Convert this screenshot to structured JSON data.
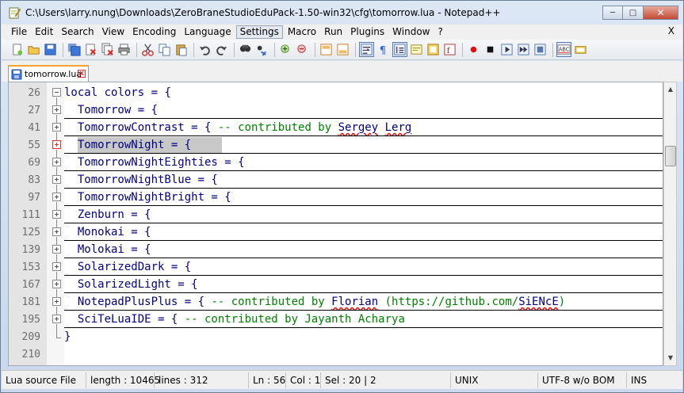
{
  "window": {
    "title": "C:\\Users\\larry.nung\\Downloads\\ZeroBraneStudioEduPack-1.50-win32\\cfg\\tomorrow.lua - Notepad++",
    "minimize_icon": "minimize-icon",
    "maximize_icon": "maximize-icon",
    "close_icon": "close-icon"
  },
  "menu": {
    "items": [
      {
        "label": "File"
      },
      {
        "label": "Edit"
      },
      {
        "label": "Search"
      },
      {
        "label": "View"
      },
      {
        "label": "Encoding"
      },
      {
        "label": "Language"
      },
      {
        "label": "Settings",
        "active": true
      },
      {
        "label": "Macro"
      },
      {
        "label": "Run"
      },
      {
        "label": "Plugins"
      },
      {
        "label": "Window"
      },
      {
        "label": "?"
      }
    ],
    "close_label": "X"
  },
  "toolbar": {
    "icons": [
      "new-file-icon",
      "open-file-icon",
      "save-icon",
      "save-all-icon",
      "close-icon",
      "close-all-icon",
      "print-icon",
      "cut-icon",
      "copy-icon",
      "paste-icon",
      "undo-icon",
      "redo-icon",
      "find-icon",
      "replace-icon",
      "zoom-in-icon",
      "zoom-out-icon",
      "sync-vertical-icon",
      "sync-horizontal-icon",
      "word-wrap-icon",
      "show-all-chars-icon",
      "indent-guide-icon",
      "user-lang-icon",
      "doc-map-icon",
      "function-list-icon",
      "record-macro-icon",
      "stop-record-icon",
      "play-macro-icon",
      "run-macro-multiple-icon",
      "save-macro-icon",
      "spell-check-icon",
      "spell-check-options-icon"
    ]
  },
  "tab": {
    "label": "tomorrow.lua",
    "close_label": "x"
  },
  "editor": {
    "lines": [
      {
        "num": "26",
        "fold": "minus",
        "parts": [
          [
            "kw",
            "local"
          ],
          [
            "op",
            " colors = {"
          ]
        ]
      },
      {
        "num": "27",
        "fold": "plus",
        "parts": [
          [
            "op",
            "  Tomorrow = {"
          ]
        ]
      },
      {
        "num": "41",
        "fold": "plus",
        "parts": [
          [
            "op",
            "  TomorrowContrast = { "
          ],
          [
            "cm",
            "-- contributed by "
          ],
          [
            "sq",
            "Sergey"
          ],
          [
            "cm",
            " "
          ],
          [
            "sq",
            "Lerg"
          ]
        ]
      },
      {
        "num": "55",
        "fold": "plus-red",
        "parts": [
          [
            "op",
            "  TomorrowNight = {"
          ]
        ],
        "highlight": true
      },
      {
        "num": "69",
        "fold": "plus",
        "parts": [
          [
            "op",
            "  TomorrowNightEighties = {"
          ]
        ]
      },
      {
        "num": "83",
        "fold": "plus",
        "parts": [
          [
            "op",
            "  TomorrowNightBlue = {"
          ]
        ]
      },
      {
        "num": "97",
        "fold": "plus",
        "parts": [
          [
            "op",
            "  TomorrowNightBright = {"
          ]
        ]
      },
      {
        "num": "111",
        "fold": "plus",
        "parts": [
          [
            "op",
            "  Zenburn = {"
          ]
        ]
      },
      {
        "num": "125",
        "fold": "plus",
        "parts": [
          [
            "op",
            "  Monokai = {"
          ]
        ]
      },
      {
        "num": "139",
        "fold": "plus",
        "parts": [
          [
            "op",
            "  Molokai = {"
          ]
        ]
      },
      {
        "num": "153",
        "fold": "plus",
        "parts": [
          [
            "op",
            "  SolarizedDark = {"
          ]
        ]
      },
      {
        "num": "167",
        "fold": "plus",
        "parts": [
          [
            "op",
            "  SolarizedLight = {"
          ]
        ]
      },
      {
        "num": "181",
        "fold": "plus",
        "parts": [
          [
            "op",
            "  NotepadPlusPlus = { "
          ],
          [
            "cm",
            "-- contributed by "
          ],
          [
            "sq",
            "Florian"
          ],
          [
            "cm",
            " (https://github.com/"
          ],
          [
            "sq",
            "SiENcE"
          ],
          [
            "cm",
            ")"
          ]
        ]
      },
      {
        "num": "195",
        "fold": "plus",
        "parts": [
          [
            "op",
            "  SciTeLuaIDE = { "
          ],
          [
            "cm",
            "-- contributed by Jayanth Acharya"
          ]
        ]
      },
      {
        "num": "209",
        "fold": "end",
        "parts": [
          [
            "op",
            "}"
          ]
        ]
      },
      {
        "num": "210",
        "fold": "none",
        "parts": []
      }
    ]
  },
  "statusbar": {
    "file_type": "Lua source File",
    "length": "length : 10465",
    "lines": "lines : 312",
    "ln": "Ln : 56",
    "col": "Col : 1",
    "sel": "Sel : 20 | 2",
    "eol": "UNIX",
    "encoding": "UTF-8 w/o BOM",
    "mode": "INS"
  }
}
